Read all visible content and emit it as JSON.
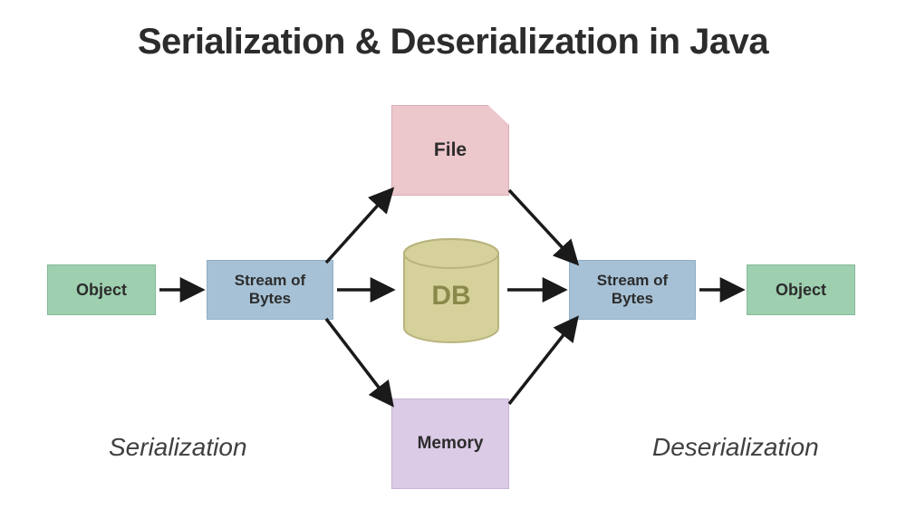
{
  "title": "Serialization & Deserialization in Java",
  "nodes": {
    "object_left": "Object",
    "stream_left": "Stream of\nBytes",
    "file": "File",
    "db": "DB",
    "memory": "Memory",
    "stream_right": "Stream of\nBytes",
    "object_right": "Object"
  },
  "captions": {
    "left": "Serialization",
    "right": "Deserialization"
  },
  "colors": {
    "object": "#9ed0b0",
    "stream": "#a6c1d6",
    "file": "#ecc7cc",
    "memory": "#dbcbe6",
    "db_fill": "#d6d19a",
    "db_stroke": "#b9b47e"
  }
}
